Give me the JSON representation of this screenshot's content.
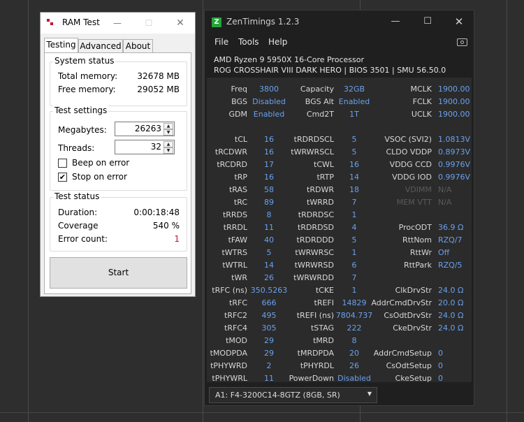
{
  "ramtest": {
    "title": "RAM Test",
    "tabs": [
      "Testing",
      "Advanced",
      "About"
    ],
    "system_status": {
      "title": "System status",
      "total_memory_label": "Total memory:",
      "total_memory_value": "32678 MB",
      "free_memory_label": "Free memory:",
      "free_memory_value": "29052 MB"
    },
    "test_settings": {
      "title": "Test settings",
      "megabytes_label": "Megabytes:",
      "megabytes_value": "26263",
      "threads_label": "Threads:",
      "threads_value": "32",
      "beep_label": "Beep on error",
      "beep_checked": false,
      "stop_label": "Stop on error",
      "stop_checked": true
    },
    "test_status": {
      "title": "Test status",
      "duration_label": "Duration:",
      "duration_value": "0:00:18:48",
      "coverage_label": "Coverage",
      "coverage_value": "540 %",
      "error_label": "Error count:",
      "error_value": "1"
    },
    "start_label": "Start"
  },
  "zen": {
    "title": "ZenTimings 1.2.3",
    "icon_letter": "Z",
    "menu": [
      "File",
      "Tools",
      "Help"
    ],
    "cpu_line": "AMD Ryzen 9 5950X 16-Core Processor",
    "board_line": "ROG CROSSHAIR VIII DARK HERO | BIOS 3501 | SMU 56.50.0",
    "left_col": [
      [
        "Freq",
        "3800"
      ],
      [
        "BGS",
        "Disabled"
      ],
      [
        "GDM",
        "Enabled"
      ],
      [
        "",
        ""
      ],
      [
        "tCL",
        "16"
      ],
      [
        "tRCDWR",
        "16"
      ],
      [
        "tRCDRD",
        "17"
      ],
      [
        "tRP",
        "16"
      ],
      [
        "tRAS",
        "58"
      ],
      [
        "tRC",
        "89"
      ],
      [
        "tRRDS",
        "8"
      ],
      [
        "tRRDL",
        "11"
      ],
      [
        "tFAW",
        "40"
      ],
      [
        "tWTRS",
        "5"
      ],
      [
        "tWTRL",
        "14"
      ],
      [
        "tWR",
        "26"
      ],
      [
        "tRFC (ns)",
        "350.5263"
      ],
      [
        "tRFC",
        "666"
      ],
      [
        "tRFC2",
        "495"
      ],
      [
        "tRFC4",
        "305"
      ],
      [
        "tMOD",
        "29"
      ],
      [
        "tMODPDA",
        "29"
      ],
      [
        "tPHYWRD",
        "2"
      ],
      [
        "tPHYWRL",
        "11"
      ]
    ],
    "mid_col": [
      [
        "Capacity",
        "32GB"
      ],
      [
        "BGS Alt",
        "Enabled"
      ],
      [
        "Cmd2T",
        "1T"
      ],
      [
        "",
        ""
      ],
      [
        "tRDRDSCL",
        "5"
      ],
      [
        "tWRWRSCL",
        "5"
      ],
      [
        "tCWL",
        "16"
      ],
      [
        "tRTP",
        "14"
      ],
      [
        "tRDWR",
        "18"
      ],
      [
        "tWRRD",
        "7"
      ],
      [
        "tRDRDSC",
        "1"
      ],
      [
        "tRDRDSD",
        "4"
      ],
      [
        "tRDRDDD",
        "5"
      ],
      [
        "tWRWRSC",
        "1"
      ],
      [
        "tWRWRSD",
        "6"
      ],
      [
        "tWRWRDD",
        "7"
      ],
      [
        "tCKE",
        "1"
      ],
      [
        "tREFI",
        "14829"
      ],
      [
        "tREFI (ns)",
        "7804.737"
      ],
      [
        "tSTAG",
        "222"
      ],
      [
        "tMRD",
        "8"
      ],
      [
        "tMRDPDA",
        "20"
      ],
      [
        "tPHYRDL",
        "26"
      ],
      [
        "PowerDown",
        "Disabled"
      ]
    ],
    "right_col": [
      [
        "MCLK",
        "1900.00"
      ],
      [
        "FCLK",
        "1900.00"
      ],
      [
        "UCLK",
        "1900.00"
      ],
      [
        "",
        ""
      ],
      [
        "VSOC (SVI2)",
        "1.0813V"
      ],
      [
        "CLDO VDDP",
        "0.8973V"
      ],
      [
        "VDDG CCD",
        "0.9976V"
      ],
      [
        "VDDG IOD",
        "0.9976V"
      ],
      [
        "VDIMM",
        "N/A"
      ],
      [
        "MEM VTT",
        "N/A"
      ],
      [
        "",
        ""
      ],
      [
        "ProcODT",
        "36.9 Ω"
      ],
      [
        "RttNom",
        "RZQ/7"
      ],
      [
        "RttWr",
        "Off"
      ],
      [
        "RttPark",
        "RZQ/5"
      ],
      [
        "",
        ""
      ],
      [
        "ClkDrvStr",
        "24.0 Ω"
      ],
      [
        "AddrCmdDrvStr",
        "20.0 Ω"
      ],
      [
        "CsOdtDrvStr",
        "24.0 Ω"
      ],
      [
        "CkeDrvStr",
        "24.0 Ω"
      ],
      [
        "",
        ""
      ],
      [
        "AddrCmdSetup",
        "0"
      ],
      [
        "CsOdtSetup",
        "0"
      ],
      [
        "CkeSetup",
        "0"
      ]
    ],
    "dimm_select": "A1: F4-3200C14-8GTZ (8GB, SR)"
  }
}
